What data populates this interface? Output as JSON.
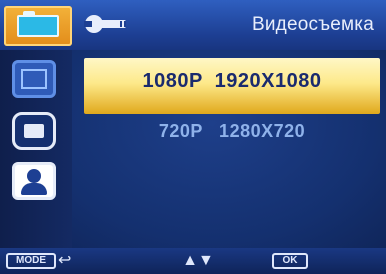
{
  "header": {
    "title": "Видеосъемка",
    "tabs": [
      {
        "name": "video-tab",
        "icon": "video-camera-icon",
        "active": true
      },
      {
        "name": "setup-tab",
        "icon": "wrench-icon",
        "active": false
      }
    ]
  },
  "sidebar": {
    "items": [
      {
        "icon": "resolution-icon",
        "selected": true
      },
      {
        "icon": "image-quality-icon",
        "selected": false
      },
      {
        "icon": "face-detection-icon",
        "selected": false
      }
    ]
  },
  "options": [
    {
      "label": "1080P  1920X1080",
      "selected": true
    },
    {
      "label": "720P   1280X720",
      "selected": false
    }
  ],
  "footer": {
    "mode_label": "MODE",
    "back_symbol": "↩",
    "nav_symbols": "▲▼",
    "ok_label": "OK"
  },
  "colors": {
    "accent": "#e28c1a",
    "highlight": "#fde98a",
    "background": "#14306f"
  }
}
